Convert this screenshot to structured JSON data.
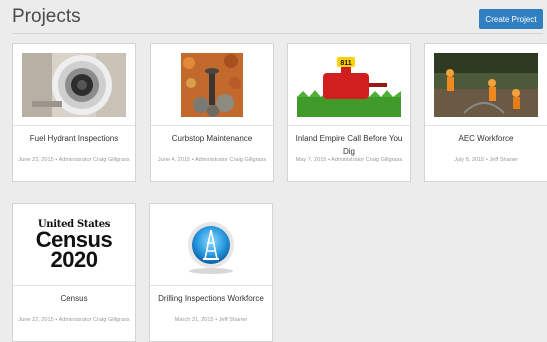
{
  "header": {
    "title": "Projects",
    "create_button": "Create Project"
  },
  "projects": [
    {
      "title": "Fuel Hydrant Inspections",
      "meta": "June 23, 2015 • Administrator Craig Gillgrass",
      "thumb_icon": "fuel-hydrant-photo"
    },
    {
      "title": "Curbstop Maintenance",
      "meta": "June 4, 2015 • Administrator Craig Gillgrass",
      "thumb_icon": "curbstop-photo"
    },
    {
      "title": "Inland Empire Call Before You Dig",
      "meta": "May 7, 2015 • Administrator Craig Gillgrass",
      "thumb_icon": "call-before-you-dig-photo",
      "badge": "811"
    },
    {
      "title": "AEC Workforce",
      "meta": "July 8, 2015 • Jeff Shaner",
      "thumb_icon": "aec-workforce-photo"
    },
    {
      "title": "Census",
      "meta": "June 22, 2015 • Administrator Craig Gillgrass",
      "thumb_icon": "census-logo",
      "logo_lines": [
        "United States",
        "Census",
        "2020"
      ]
    },
    {
      "title": "Drilling Inspections Workforce",
      "meta": "March 31, 2015 • Jeff Shaner",
      "thumb_icon": "drilling-rig-icon"
    }
  ],
  "colors": {
    "accent": "#2f7fc1",
    "background": "#ececec"
  }
}
